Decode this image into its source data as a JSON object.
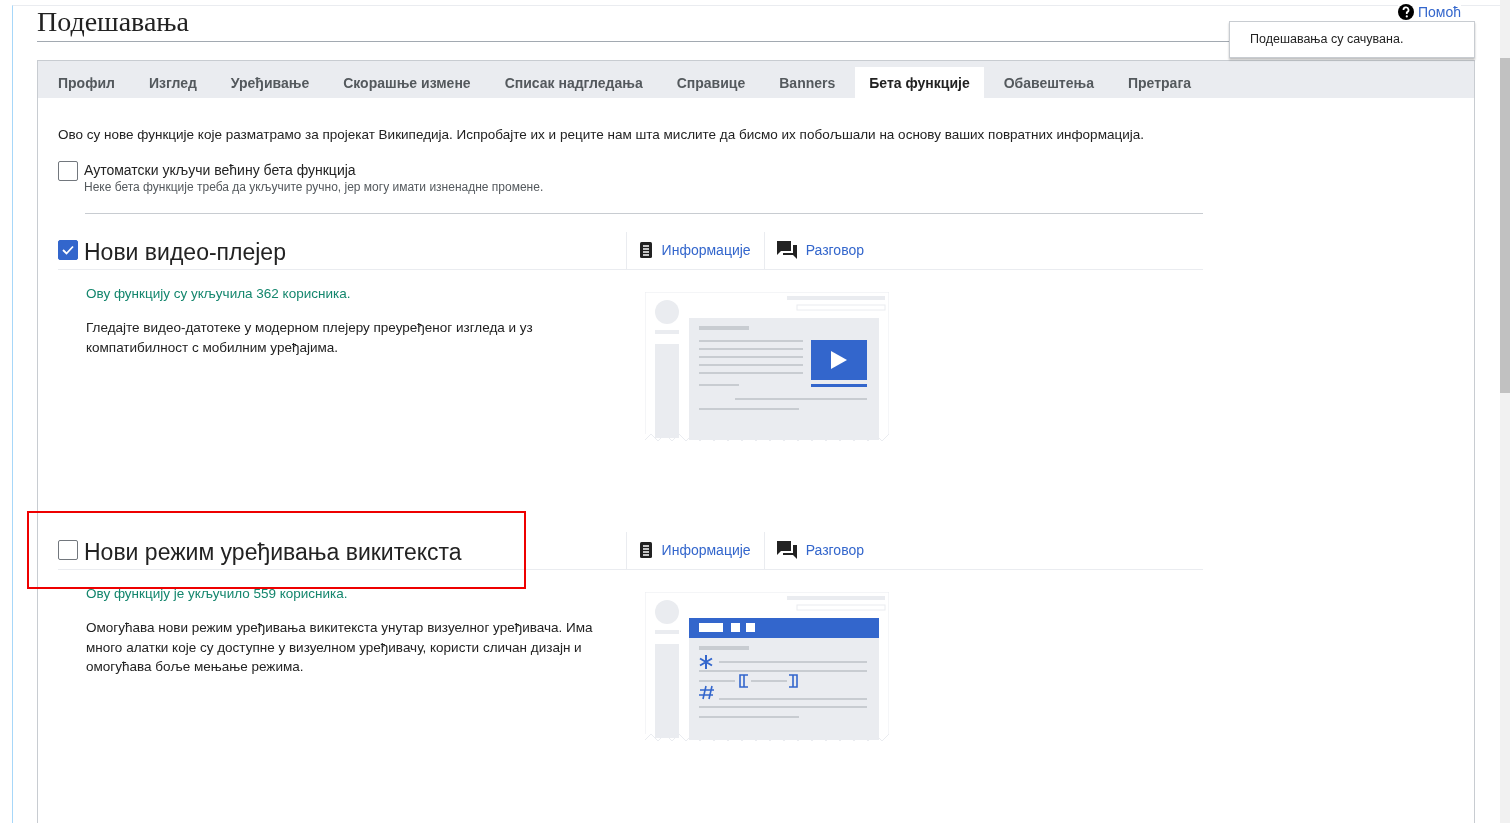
{
  "page_title": "Подешавања",
  "help_link": "Помоћ",
  "notification": "Подешавања су сачувана.",
  "tabs": [
    {
      "label": "Профил",
      "selected": false
    },
    {
      "label": "Изглед",
      "selected": false
    },
    {
      "label": "Уређивање",
      "selected": false
    },
    {
      "label": "Скорашње измене",
      "selected": false
    },
    {
      "label": "Списак надгледања",
      "selected": false
    },
    {
      "label": "Справице",
      "selected": false
    },
    {
      "label": "Banners",
      "selected": false
    },
    {
      "label": "Бета функције",
      "selected": true
    },
    {
      "label": "Обавештења",
      "selected": false
    },
    {
      "label": "Претрага",
      "selected": false
    }
  ],
  "intro": "Ово су нове функције које разматрамо за пројекат Википедија. Испробајте их и реците нам шта мислите да бисмо их побољшали на основу ваших повратних информација.",
  "auto_enable": {
    "label": "Аутоматски укључи већину бета функција",
    "hint": "Неке бета функције треба да укључите ручно, јер могу имати изненадне промене.",
    "checked": false
  },
  "features": [
    {
      "title": "Нови видео-плејер",
      "checked": true,
      "highlighted": false,
      "info_link": "Информације",
      "talk_link": "Разговор",
      "users": "Ову функцију су укључила 362 корисника.",
      "description": "Гледајте видео-датотеке у модерном плејеру преуређеног изгледа и уз компатибилност с мобилним уређајима.",
      "kind": "video"
    },
    {
      "title": "Нови режим уређивања викитекста",
      "checked": false,
      "highlighted": true,
      "info_link": "Информације",
      "talk_link": "Разговор",
      "users": "Ову функцију је укључило 559 корисника.",
      "description": "Омогућава нови режим уређивања викитекста унутар визуелног уређивача. Има много алатки које су доступне у визуелном уређивачу, користи сличан дизајн и омогућава боље мењање режима.",
      "kind": "wikitext"
    }
  ]
}
